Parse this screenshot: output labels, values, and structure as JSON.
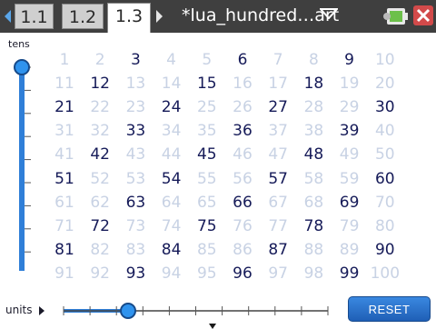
{
  "topbar": {
    "tabs": [
      {
        "label": "1.1",
        "active": false
      },
      {
        "label": "1.2",
        "active": false
      },
      {
        "label": "1.3",
        "active": true
      }
    ],
    "document_title": "*lua_hundred…art",
    "icons": [
      "nav-left-icon",
      "nav-right-icon",
      "dropdown-caret-icon",
      "battery-icon",
      "close-icon"
    ]
  },
  "tens": {
    "label": "tens",
    "value": 0
  },
  "units": {
    "label": "units",
    "value": 3,
    "max": 9
  },
  "grid": {
    "columns": 10,
    "rows": 10,
    "highlight_every": 3,
    "start": 1,
    "end": 100
  },
  "reset": {
    "label": "RESET"
  },
  "colors": {
    "highlight": "#151a58",
    "dim": "#c8d2e4",
    "accent": "#2f7fd8"
  }
}
